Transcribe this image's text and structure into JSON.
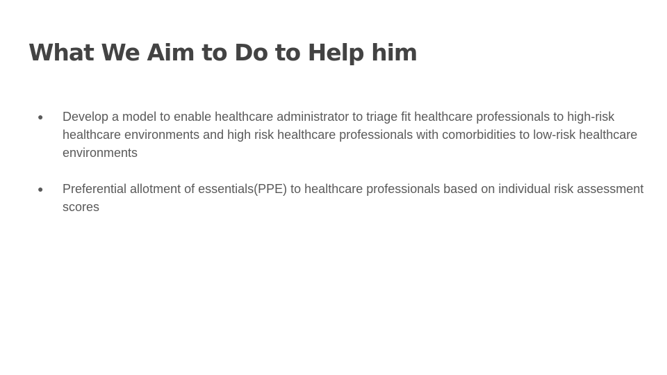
{
  "slide": {
    "title": "What We Aim to Do to Help him",
    "bullet_glyph": "●",
    "bullets": [
      "Develop a model to enable healthcare administrator to triage fit healthcare professionals to high-risk healthcare environments and high risk healthcare professionals with comorbidities to low-risk healthcare environments",
      "Preferential allotment of essentials(PPE) to healthcare professionals based on individual risk assessment scores"
    ]
  }
}
